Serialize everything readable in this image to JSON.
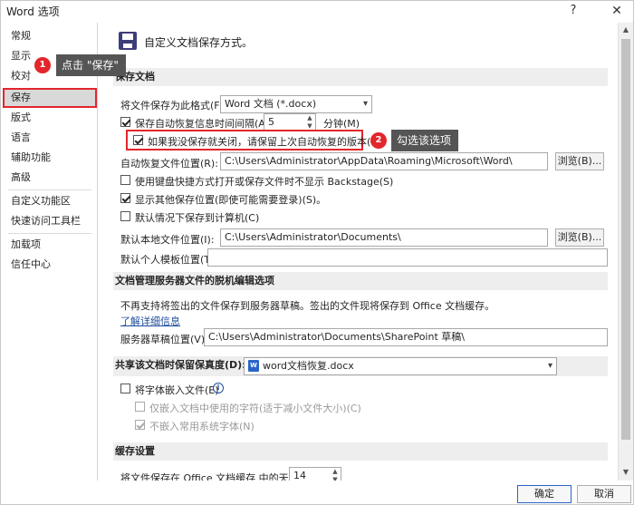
{
  "window": {
    "title": "Word 选项",
    "help": "?",
    "close": "✕"
  },
  "sidebar": {
    "items": [
      "常规",
      "显示",
      "校对",
      "保存",
      "版式",
      "语言",
      "辅助功能",
      "高级",
      "自定义功能区",
      "快速访问工具栏",
      "加载项",
      "信任中心"
    ],
    "active": "保存"
  },
  "header": {
    "title": "自定义文档保存方式。"
  },
  "sections": {
    "save_docs": "保存文档",
    "offline": "文档管理服务器文件的脱机编辑选项",
    "fidelity_label": "共享该文档时保留保真度(D):",
    "cache": "缓存设置"
  },
  "save": {
    "format_label": "将文件保存为此格式(F):",
    "format_value": "Word 文档 (*.docx)",
    "autorecover_label": "保存自动恢复信息时间间隔(A)",
    "autorecover_value": "5",
    "minutes_label": "分钟(M)",
    "keep_last_label": "如果我没保存就关闭，请保留上次自动恢复的版本(U)",
    "autorecover_path_label": "自动恢复文件位置(R):",
    "autorecover_path_value": "C:\\Users\\Administrator\\AppData\\Roaming\\Microsoft\\Word\\",
    "browse1": "浏览(B)...",
    "no_backstage_label": "使用键盘快捷方式打开或保存文件时不显示 Backstage(S)",
    "show_other_label": "显示其他保存位置(即使可能需要登录)(S)。",
    "default_computer_label": "默认情况下保存到计算机(C)",
    "default_local_label": "默认本地文件位置(I):",
    "default_local_value": "C:\\Users\\Administrator\\Documents\\",
    "browse2": "浏览(B)...",
    "template_label": "默认个人模板位置(T):",
    "template_value": ""
  },
  "offline": {
    "desc": "不再支持将签出的文件保存到服务器草稿。签出的文件现将保存到 Office 文档缓存。",
    "learn_more": "了解详细信息",
    "drafts_label": "服务器草稿位置(V):",
    "drafts_value": "C:\\Users\\Administrator\\Documents\\SharePoint 草稿\\"
  },
  "fidelity": {
    "doc_value": "word文档恢复.docx",
    "embed_fonts_label": "将字体嵌入文件(E)",
    "embed_only_label": "仅嵌入文档中使用的字符(适于减小文件大小)(C)",
    "no_common_label": "不嵌入常用系统字体(N)"
  },
  "cache": {
    "days_label": "将文件保存在 Office 文档缓存 中的天数:",
    "days_value": "14"
  },
  "footer": {
    "ok": "确定",
    "cancel": "取消"
  },
  "annotations": {
    "step1_num": "1",
    "step1_text": "点击 \"保存\"",
    "step2_num": "2",
    "step2_text": "勾选该选项"
  },
  "icons": {
    "save": "save-disk-icon",
    "info": "info-icon",
    "word_doc": "word-doc-icon"
  },
  "colors": {
    "accent": "#2b64c7",
    "highlight": "#e3262b",
    "callout": "#555555"
  }
}
